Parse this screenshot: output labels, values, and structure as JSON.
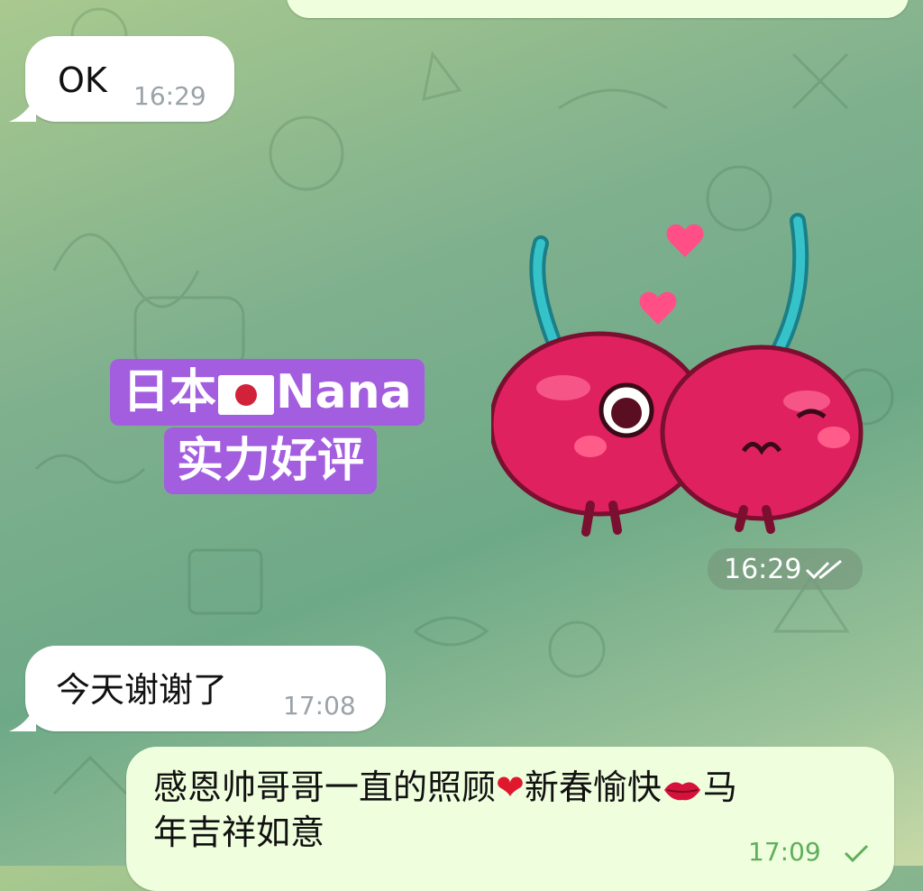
{
  "messages": [
    {
      "text": "OK",
      "time": "16:29"
    },
    {
      "time": "16:29",
      "caption_line1": "日本",
      "caption_brand": "Nana",
      "caption_line2": "实力好评"
    },
    {
      "text": "今天谢谢了",
      "time": "17:08"
    },
    {
      "text_line1": "感恩帅哥哥一直的照顾",
      "text_mid": "新春愉快",
      "text_end": "马",
      "text_line2": "年吉祥如意",
      "time": "17:09"
    }
  ],
  "colors": {
    "incoming": "#ffffff",
    "outgoing": "#effedd",
    "caption_bg": "#a35ee0",
    "cherry": "#e0215f",
    "read_check": "#5fae5c"
  },
  "icons": [
    "double-check-icon",
    "single-check-icon",
    "japan-flag-icon",
    "red-heart-icon",
    "kiss-lips-icon"
  ]
}
